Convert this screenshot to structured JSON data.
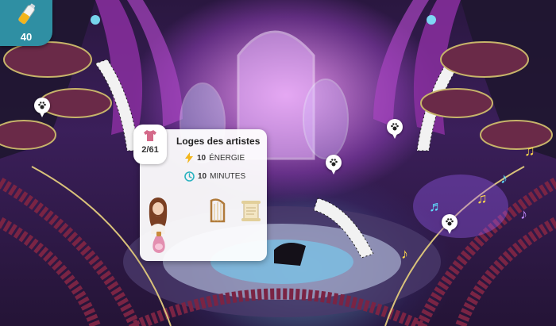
{
  "hud": {
    "energy_count": "40",
    "icon": "energy-drink-icon"
  },
  "location_card": {
    "progress": "2/61",
    "title": "Loges des artistes",
    "energy_value": "10",
    "energy_unit": "ÉNERGIE",
    "time_value": "10",
    "time_unit": "MINUTES",
    "icons": {
      "progress": "shirt-icon",
      "energy": "lightning-icon",
      "time": "clock-icon"
    },
    "rewards": [
      "character-portrait",
      "harp-icon",
      "scroll-icon",
      "potion-bottle-icon"
    ]
  },
  "map_pins": [
    "paw-pin",
    "paw-pin",
    "paw-pin",
    "paw-pin"
  ],
  "colors": {
    "accent": "#2f8fa3",
    "energy": "#f2b51b",
    "clock": "#2bb3c0",
    "shirt": "#d46a8a"
  }
}
